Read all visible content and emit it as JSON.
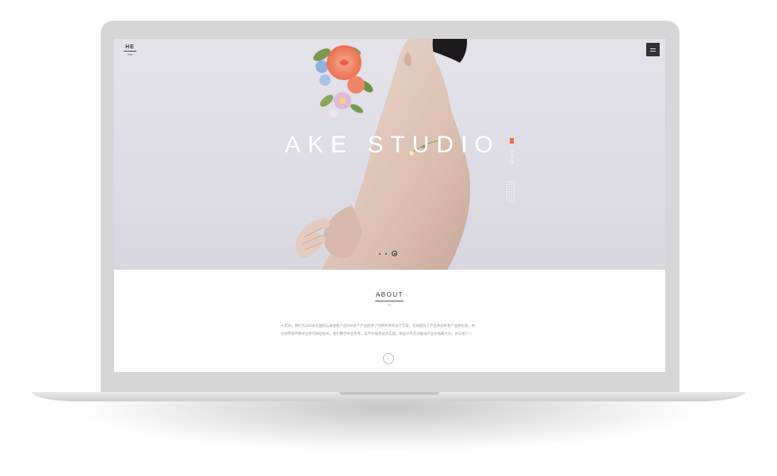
{
  "logo": {
    "main": "HE",
    "sub": "me"
  },
  "hero": {
    "title": "AKE STUDIO",
    "side_tag": "SARAH",
    "slides_total": 3,
    "active_slide": 3
  },
  "about": {
    "title": "ABOUT",
    "number": "01",
    "text_lines": [
      "十年间，我们为200多名国际与本地客户创200多个产品提供了创新务用的设计方案，有效提升了产品体验和客户品牌价值，并",
      "引领市场不断树立新的体验标杆。我们整合商业思考，美学价值及技术实现，用设计的方法推动产品价值最大化，并与客户一"
    ],
    "more_label": "›"
  },
  "colors": {
    "accent": "#ee6a4e",
    "hero_bg": "#e0dfe7",
    "menu_bg": "#333333",
    "frame": "#d6d6d6"
  },
  "icons": {
    "menu": "hamburger-icon",
    "more": "chevron-right-icon"
  }
}
